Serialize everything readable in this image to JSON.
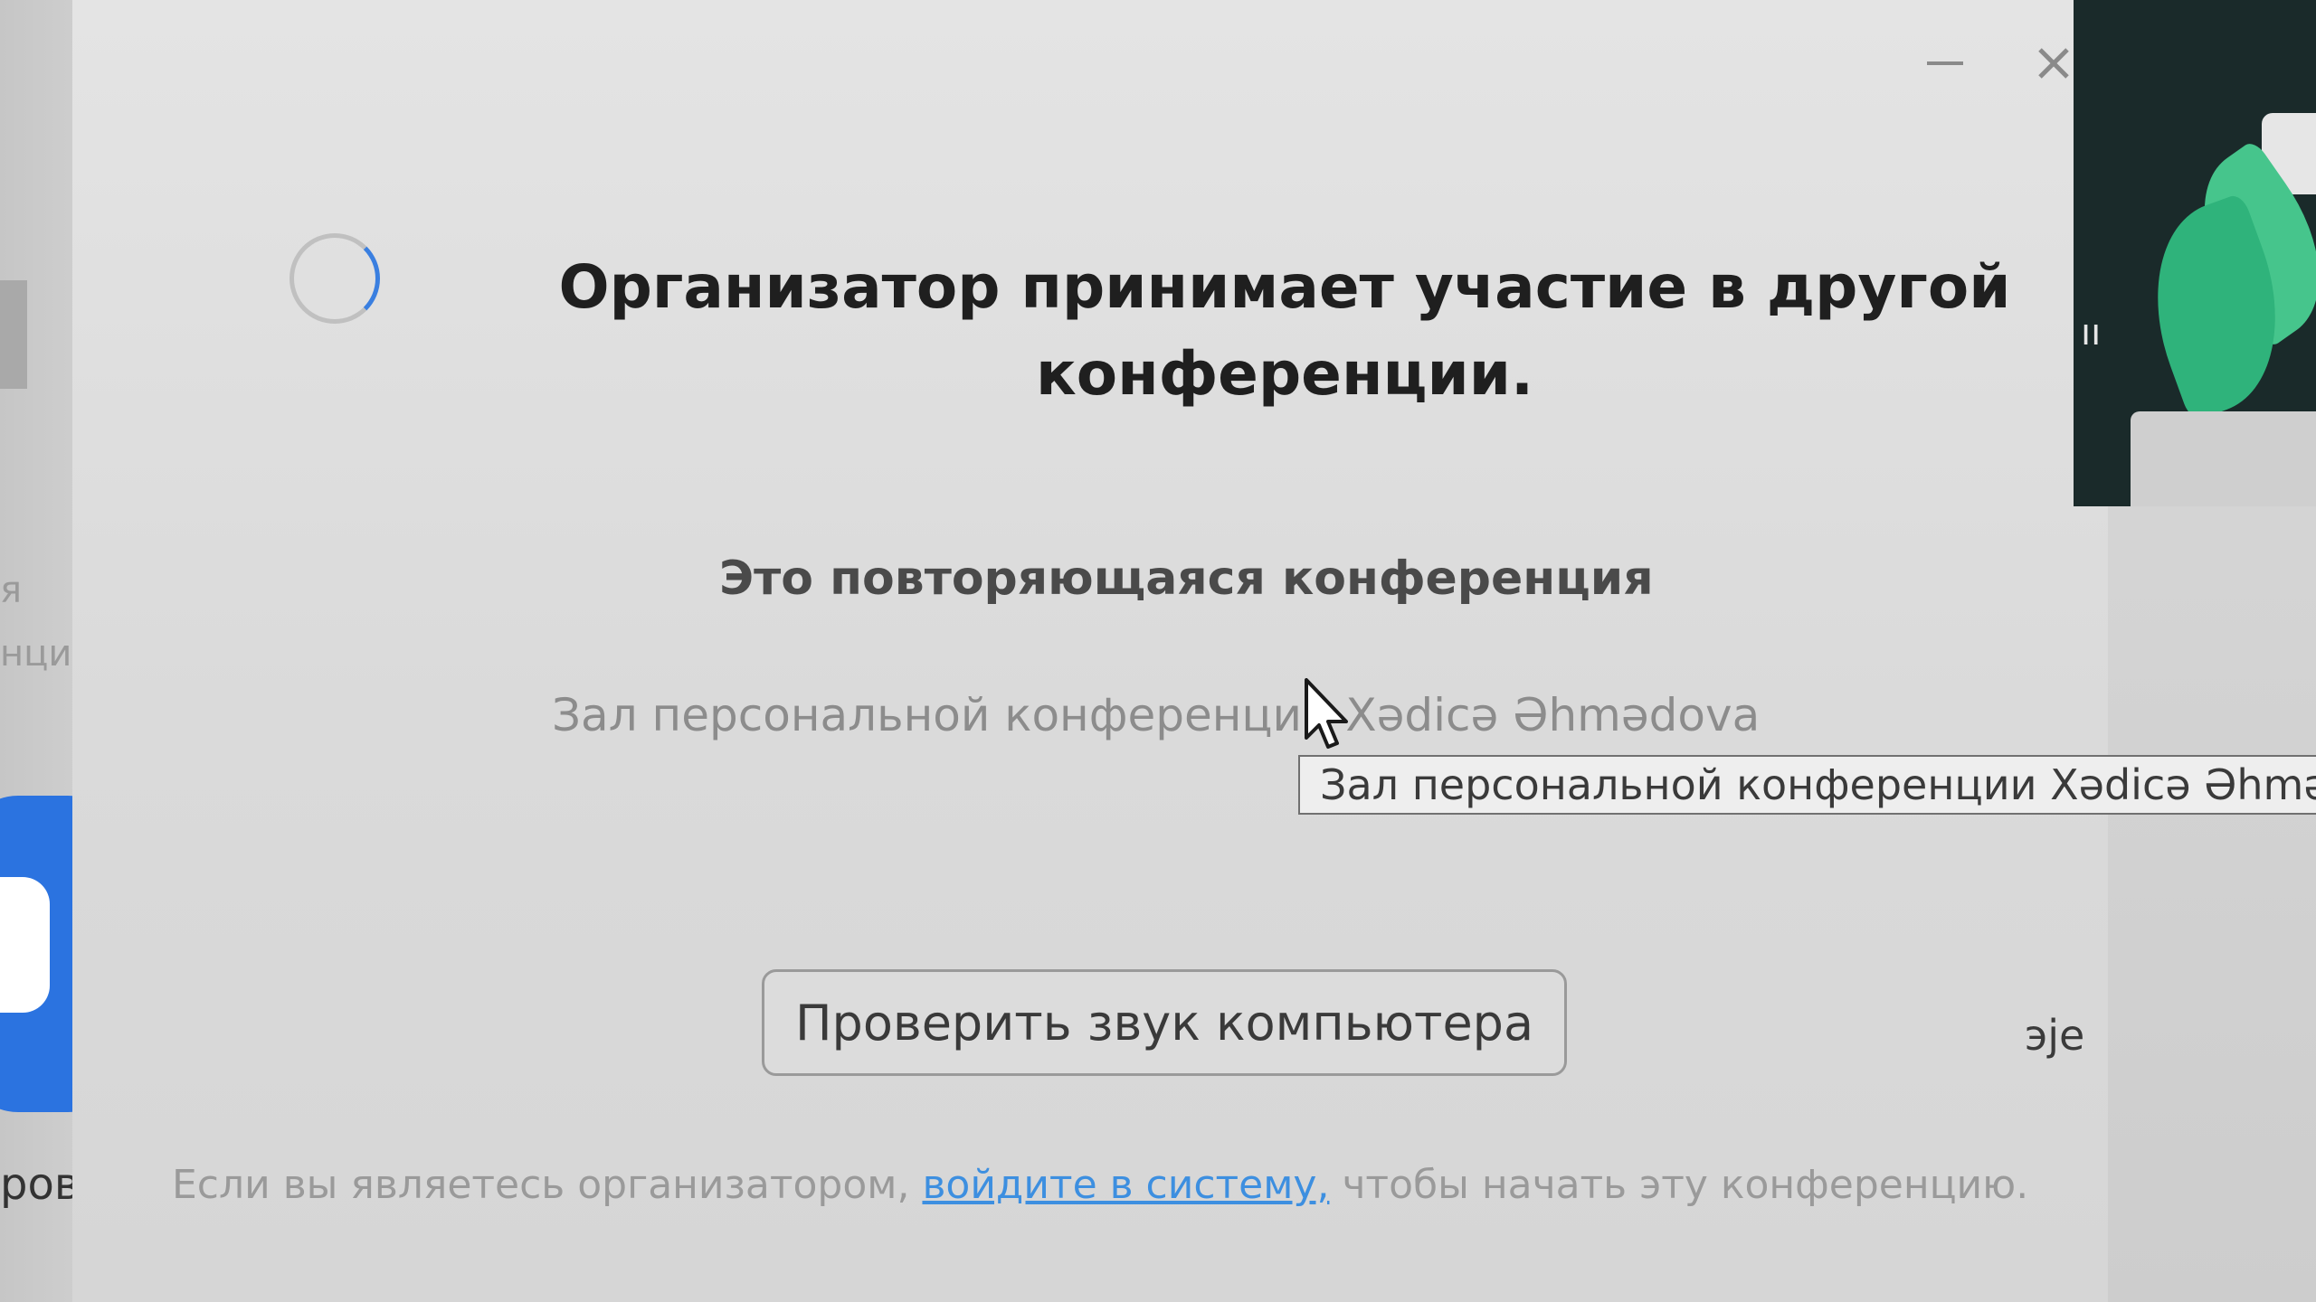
{
  "background": {
    "left_app": {
      "text_fragment_1": "я",
      "text_fragment_2": "нция",
      "bottom_word": "роват"
    },
    "right_app": {
      "glyph": "ıı",
      "text_fragment": "эје"
    }
  },
  "dialog": {
    "title": "Организатор принимает участие в другой конференции.",
    "subtitle": "Это повторяющаяся конференция",
    "room_name": "Зал персональной конференции Xədicə Əhmədova",
    "tooltip": "Зал персональной конференции Xədicə Əhmədova",
    "test_audio_button": "Проверить звук компьютера",
    "footer": {
      "before_link": "Если вы являетесь организатором,",
      "link": "войдите в систему,",
      "after_link": "чтобы начать эту конференцию."
    },
    "controls": {
      "minimize_icon": "minimize-icon",
      "close_icon": "close-icon"
    }
  },
  "colors": {
    "link": "#3d8fe0",
    "spinner_accent": "#3a7fe0",
    "app_tile_blue": "#2b73e0",
    "plant_green": "#2fb37b"
  }
}
